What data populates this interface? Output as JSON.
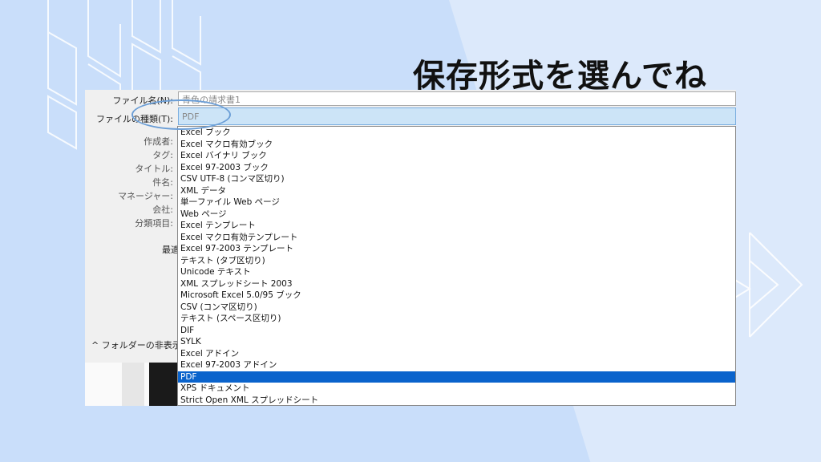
{
  "slide": {
    "title": "保存形式を選んでね"
  },
  "dialog": {
    "labels": {
      "file_name": "ファイル名(N):",
      "file_type": "ファイルの種類(T):",
      "author": "作成者:",
      "tags": "タグ:",
      "title": "タイトル:",
      "subject": "件名:",
      "manager": "マネージャー:",
      "company": "会社:",
      "category": "分類項目:",
      "partial": "最適"
    },
    "file_name_value": "青色の請求書1",
    "file_type_value": "PDF",
    "hide_folders": "フォルダーの非表示",
    "hide_folders_icon": "^",
    "file_types": [
      "Excel ブック",
      "Excel マクロ有効ブック",
      "Excel バイナリ ブック",
      "Excel 97-2003 ブック",
      "CSV UTF-8 (コンマ区切り)",
      "XML データ",
      "単一ファイル Web ページ",
      "Web ページ",
      "Excel テンプレート",
      "Excel マクロ有効テンプレート",
      "Excel 97-2003 テンプレート",
      "テキスト (タブ区切り)",
      "Unicode テキスト",
      "XML スプレッドシート 2003",
      "Microsoft Excel 5.0/95 ブック",
      "CSV (コンマ区切り)",
      "テキスト (スペース区切り)",
      "DIF",
      "SYLK",
      "Excel アドイン",
      "Excel 97-2003 アドイン",
      "PDF",
      "XPS ドキュメント",
      "Strict Open XML スプレッドシート"
    ],
    "selected_type": "PDF"
  },
  "colors": {
    "background": "#c9defa",
    "selection": "#0a63cc",
    "highlight_circle": "#6b9ed6"
  }
}
